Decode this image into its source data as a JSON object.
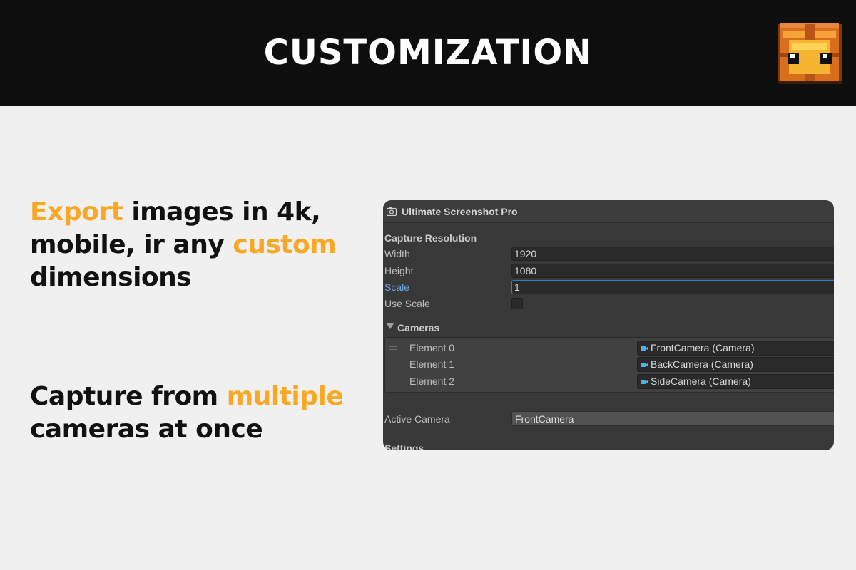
{
  "header": {
    "title": "CUSTOMIZATION",
    "logo_icon": "pixel-treasure-chest-icon"
  },
  "features": {
    "export": {
      "accent_1": "Export",
      "text_1": " images in 4k, mobile, ir any ",
      "accent_2": "custom",
      "text_2": " dimensions"
    },
    "capture": {
      "text_1": "Capture from ",
      "accent_1": "multiple",
      "text_2": " cameras at once"
    }
  },
  "inspector": {
    "title": "Ultimate Screenshot Pro",
    "title_icon": "component-icon",
    "capture_resolution": {
      "section_label": "Capture Resolution",
      "width_label": "Width",
      "width_value": "1920",
      "height_label": "Height",
      "height_value": "1080",
      "scale_label": "Scale",
      "scale_value": "1",
      "use_scale_label": "Use Scale",
      "use_scale_checked": false
    },
    "cameras": {
      "section_label": "Cameras",
      "items": [
        {
          "label": "Element 0",
          "value": "FrontCamera (Camera)"
        },
        {
          "label": "Element 1",
          "value": "BackCamera (Camera)"
        },
        {
          "label": "Element 2",
          "value": "SideCamera (Camera)"
        }
      ]
    },
    "active_camera": {
      "label": "Active Camera",
      "value": "FrontCamera"
    },
    "settings_label": "Settings"
  },
  "colors": {
    "accent": "#f9a825",
    "header_bg": "#0e0e0e",
    "page_bg": "#f0f0f0",
    "panel_bg": "#383838",
    "active_label": "#6ea4e0",
    "focus_border": "#3a79bb"
  }
}
